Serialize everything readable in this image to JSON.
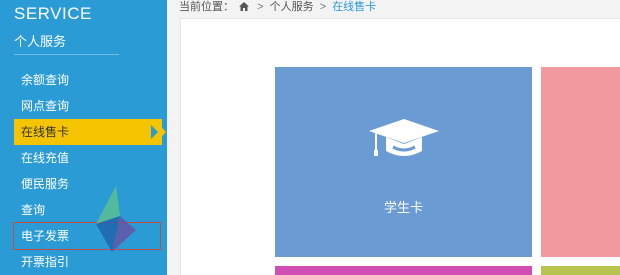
{
  "sidebar": {
    "brand_en": "SERVICE",
    "brand_cn": "个人服务",
    "items": [
      {
        "label": "余额查询"
      },
      {
        "label": "网点查询"
      },
      {
        "label": "在线售卡"
      },
      {
        "label": "在线充值"
      },
      {
        "label": "便民服务"
      },
      {
        "label": "查询"
      },
      {
        "label": "电子发票"
      },
      {
        "label": "开票指引"
      }
    ],
    "active_item": "在线售卡",
    "highlighted_item": "电子发票"
  },
  "breadcrumb": {
    "prefix": "当前位置：",
    "sep1": ">",
    "level1": "个人服务",
    "sep2": ">",
    "current": "在线售卡"
  },
  "tiles": {
    "student": {
      "label": "学生卡",
      "icon": "graduation-cap-icon"
    }
  },
  "colors": {
    "sidebar": "#2b9bd5",
    "active": "#f5c400",
    "tile_student": "#6a9bd3",
    "tile_pink": "#f09aa0",
    "tile_magenta": "#d14fb2",
    "tile_green": "#b6c44f"
  }
}
